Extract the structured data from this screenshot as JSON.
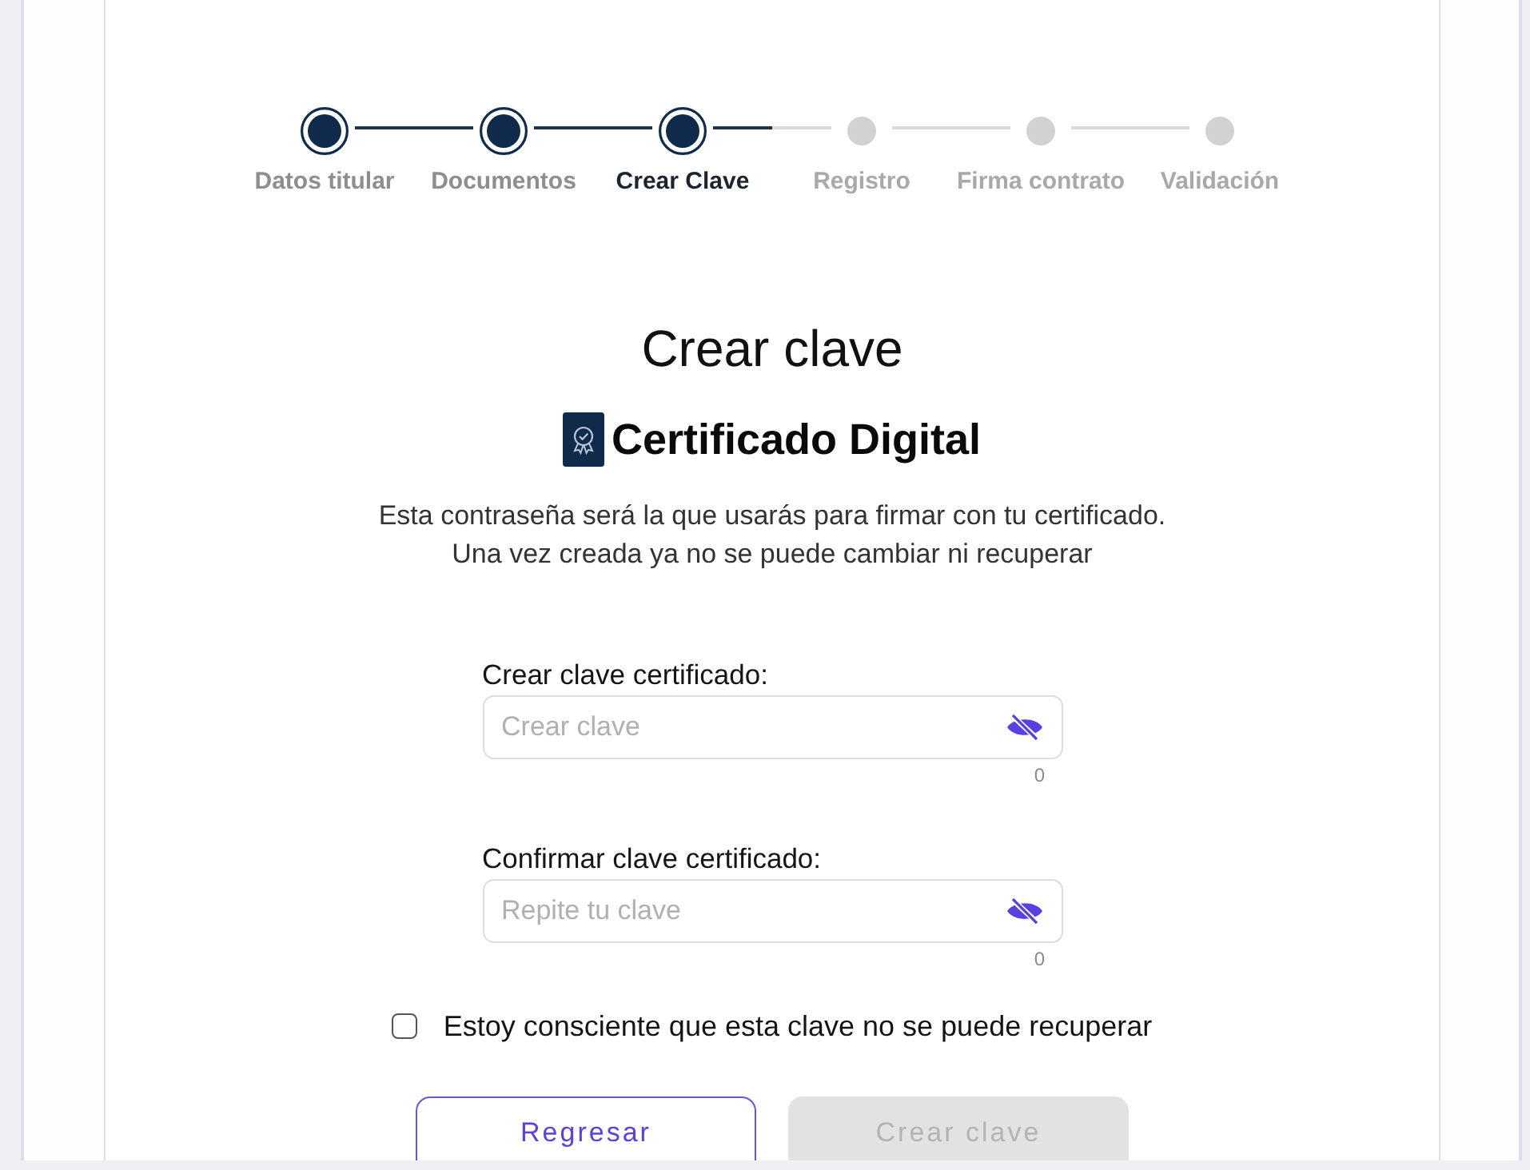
{
  "stepper": {
    "steps": [
      {
        "label": "Datos titular",
        "completed": true,
        "selected": false
      },
      {
        "label": "Documentos",
        "completed": true,
        "selected": false
      },
      {
        "label": "Crear Clave",
        "completed": true,
        "selected": true
      },
      {
        "label": "Registro",
        "completed": false,
        "selected": false
      },
      {
        "label": "Firma contrato",
        "completed": false,
        "selected": false
      },
      {
        "label": "Validación",
        "completed": false,
        "selected": false
      }
    ]
  },
  "title": "Crear clave",
  "certificate": {
    "title": "Certificado Digital"
  },
  "description": {
    "lines": [
      "Esta contraseña será la que usarás para firmar con tu certificado.",
      "Una vez creada ya no se puede cambiar ni recuperar"
    ]
  },
  "fields": [
    {
      "label": "Crear clave certificado:",
      "placeholder": "Crear clave",
      "counter": "0",
      "visible": false
    },
    {
      "label": "Confirmar clave certificado:",
      "placeholder": "Repite tu clave",
      "counter": "0",
      "visible": false
    }
  ],
  "acknowledgement": {
    "label": "Estoy consciente que esta clave no se puede recuperar",
    "checked": false
  },
  "buttons": [
    {
      "label": "Regresar",
      "kind": "outline",
      "disabled": false
    },
    {
      "label": "Crear clave",
      "kind": "primary",
      "disabled": true
    }
  ]
}
